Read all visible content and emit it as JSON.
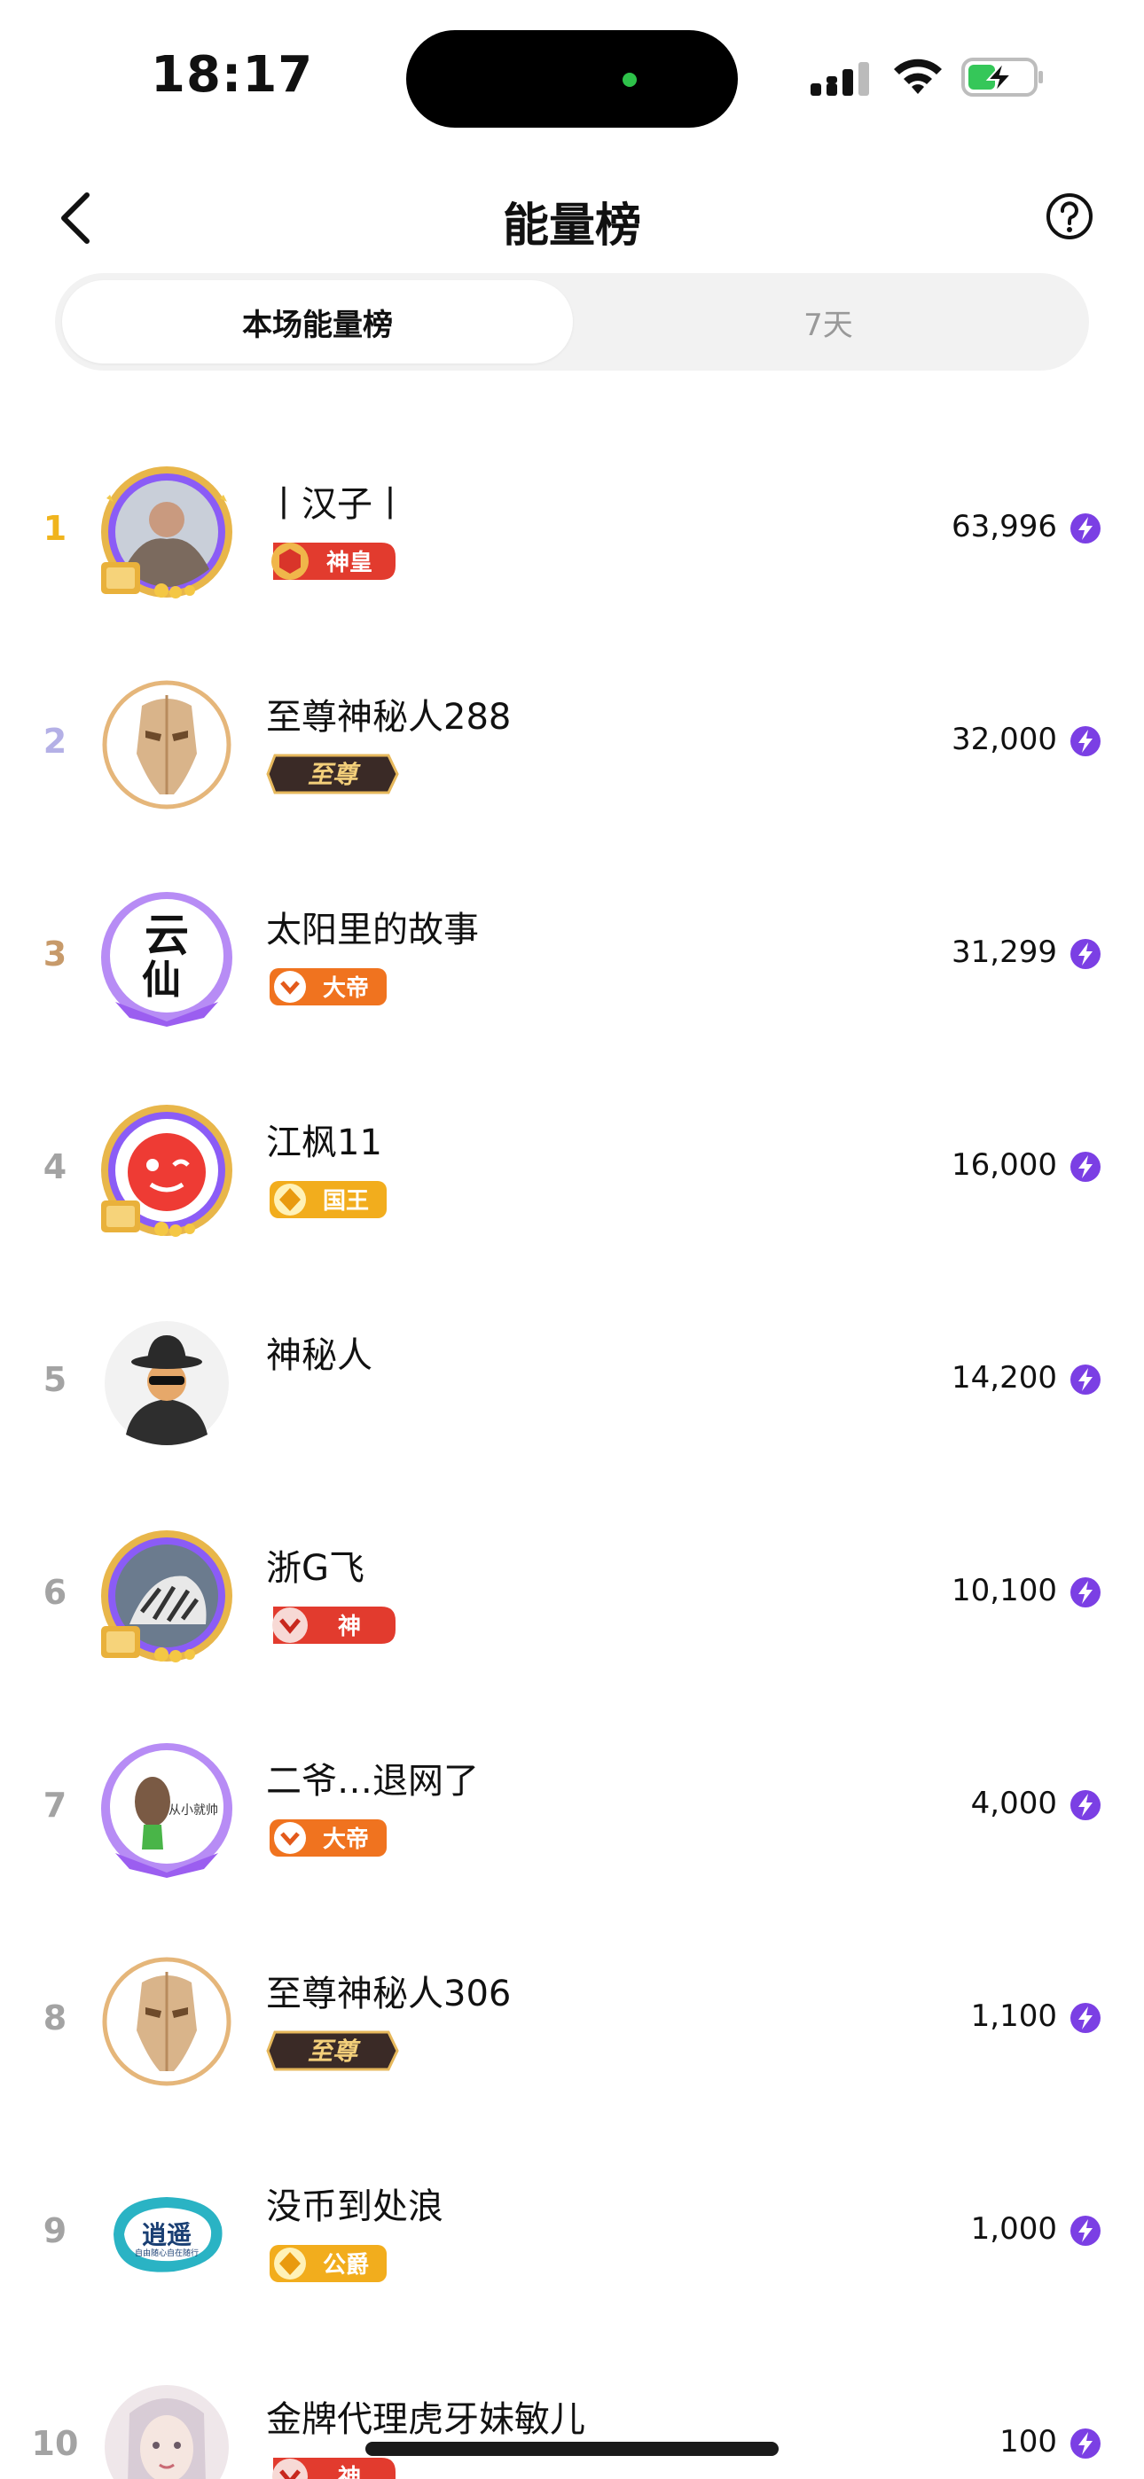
{
  "status": {
    "time": "18:17"
  },
  "header": {
    "title": "能量榜"
  },
  "tabs": [
    {
      "label": "本场能量榜",
      "active": true
    },
    {
      "label": "7天",
      "active": false
    }
  ],
  "ranking": [
    {
      "rank": "1",
      "name": "丨汉子丨",
      "badge": "神皇",
      "score": "63,996"
    },
    {
      "rank": "2",
      "name": "至尊神秘人288",
      "badge": "至尊",
      "score": "32,000"
    },
    {
      "rank": "3",
      "name": "太阳里的故事",
      "badge": "大帝",
      "score": "31,299"
    },
    {
      "rank": "4",
      "name": "江枫11",
      "badge": "国王",
      "score": "16,000"
    },
    {
      "rank": "5",
      "name": "神秘人",
      "badge": "",
      "score": "14,200"
    },
    {
      "rank": "6",
      "name": "浙G飞",
      "badge": "神",
      "score": "10,100"
    },
    {
      "rank": "7",
      "name": "二爷…退网了",
      "badge": "大帝",
      "score": "4,000"
    },
    {
      "rank": "8",
      "name": "至尊神秘人306",
      "badge": "至尊",
      "score": "1,100"
    },
    {
      "rank": "9",
      "name": "没币到处浪",
      "badge": "公爵",
      "score": "1,000"
    },
    {
      "rank": "10",
      "name": "金牌代理虎牙妹敏儿",
      "badge": "神",
      "score": "100"
    }
  ],
  "avatar_text": {
    "a3_glyph1": "云",
    "a3_glyph2": "仙",
    "a7_glyph": "从小就帅",
    "a9_glyph": "逍遥",
    "a9_sub": "自由随心自在随行",
    "coin_label": "金币"
  },
  "colors": {
    "rank1": "#f0b41d",
    "rank2": "#b4b0e6",
    "rank3": "#c79a6a",
    "rank_other": "#a3a3a3",
    "tab_bg": "#f2f2f2",
    "energy_purple": "#7b3fe4"
  },
  "icons": {
    "back": "chevron-left-icon",
    "help": "question-circle-icon",
    "energy": "lightning-icon"
  }
}
